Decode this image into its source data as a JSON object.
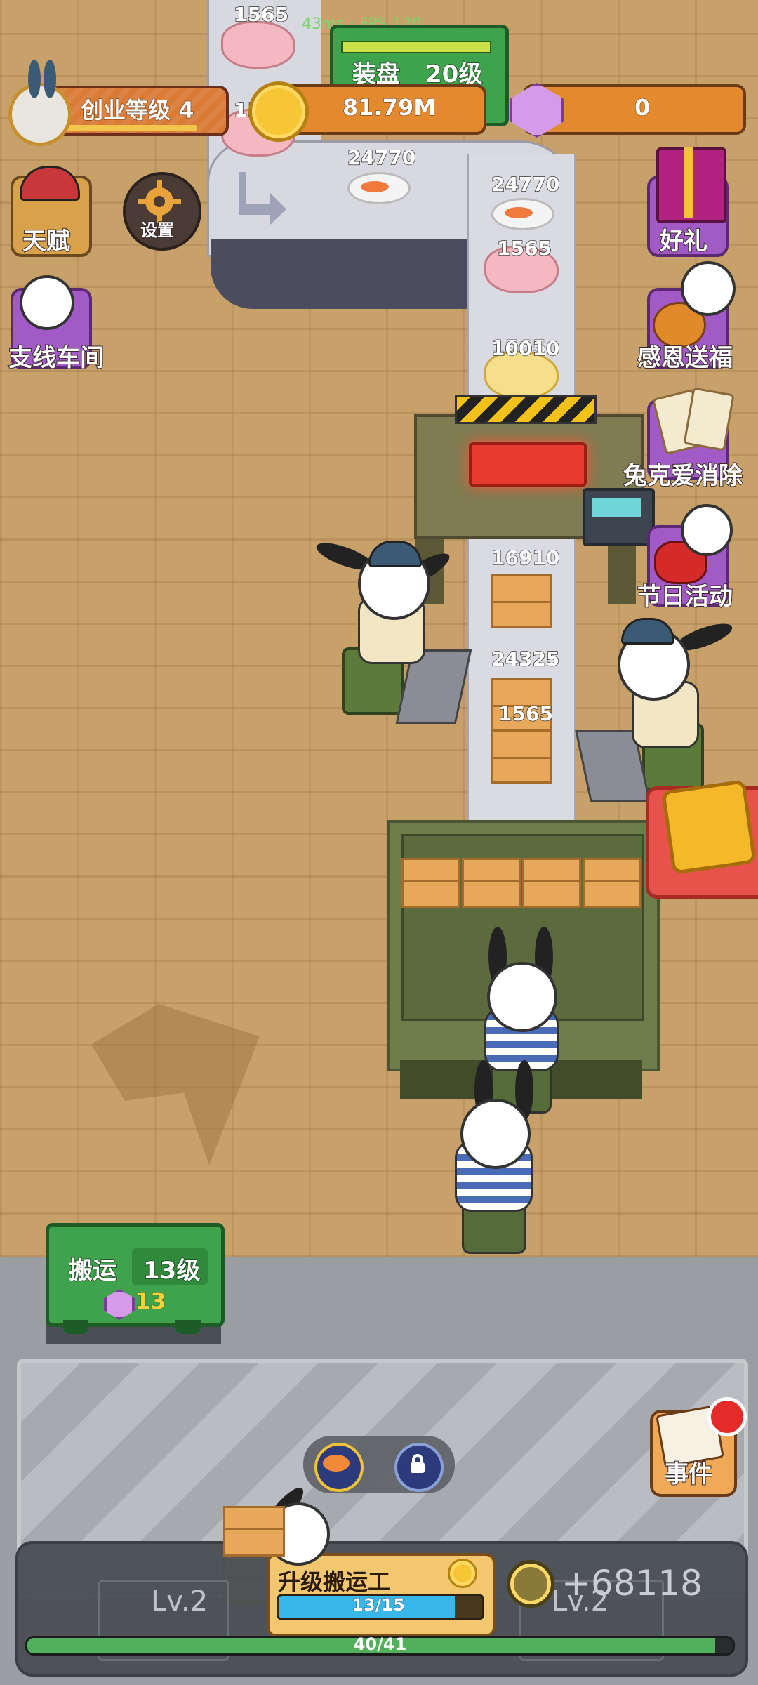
{
  "hud": {
    "status": "43ms · FPS 120",
    "level_label": "创业等级 4",
    "coins": "81.79M",
    "gems": "0"
  },
  "stations": {
    "plating": {
      "name": "装盘",
      "level": "20级"
    },
    "transport": {
      "name": "搬运",
      "level": "13级",
      "cost": "13"
    }
  },
  "side_left": {
    "talent": "天赋",
    "settings": "设置",
    "branch_workshop": "支线车间"
  },
  "side_right": {
    "gift": "好礼",
    "thanksgiving": "感恩送福",
    "mahjong": "兔克爱消除",
    "festival": "节日活动",
    "events": "事件"
  },
  "items": {
    "chicken_top_left": "1565",
    "chicken_top_left_2": "15",
    "plate_left": "24770",
    "plate_right": "24770",
    "chicken_belt": "1565",
    "chicken_belt_under": "1565",
    "gold_chicken": "10010",
    "box_1": "16910",
    "box_2": "24325",
    "box_3": "1565"
  },
  "bottom": {
    "upgrade_label": "升级搬运工",
    "upgrade_progress_text": "13/15",
    "upgrade_progress": 0.8667,
    "income": "+68118",
    "lv_left": "Lv.2",
    "lv_right": "Lv.2",
    "capacity_text": "40/41",
    "capacity_progress": 0.9756
  },
  "colors": {
    "accent_orange": "#e38a2f",
    "gem_purple": "#d59be8",
    "progress_green": "#52b05c",
    "upgrade_blue": "#38b8ea"
  }
}
